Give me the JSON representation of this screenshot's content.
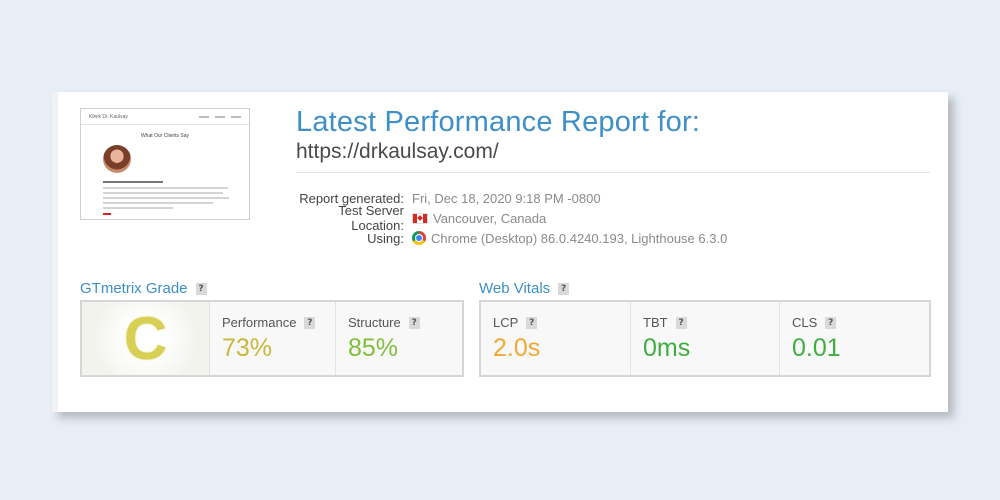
{
  "report": {
    "title": "Latest Performance Report for:",
    "url": "https://drkaulsay.com/",
    "meta": [
      {
        "label": "Report generated:",
        "value": "Fri, Dec 18, 2020 9:18 PM -0800",
        "icon": ""
      },
      {
        "label": "Test Server Location:",
        "value": "Vancouver, Canada",
        "icon": "canada-flag-icon"
      },
      {
        "label": "Using:",
        "value": "Chrome (Desktop) 86.0.4240.193, Lighthouse 6.3.0",
        "icon": "chrome-icon"
      }
    ]
  },
  "thumbnail": {
    "brand": "Klinik Dr. Kaulsay",
    "heading": "What Our Clients Say"
  },
  "gtmetrix": {
    "label": "GTmetrix Grade",
    "help": "?",
    "grade": "C",
    "grade_color": "#d8cf55",
    "performance": {
      "label": "Performance",
      "value": "73%",
      "color": "#c9b73a"
    },
    "structure": {
      "label": "Structure",
      "value": "85%",
      "color": "#7fbf3a"
    }
  },
  "web_vitals": {
    "label": "Web Vitals",
    "help": "?",
    "lcp": {
      "label": "LCP",
      "value": "2.0s",
      "color": "#f0a830"
    },
    "tbt": {
      "label": "TBT",
      "value": "0ms",
      "color": "#3fae3f"
    },
    "cls": {
      "label": "CLS",
      "value": "0.01",
      "color": "#3fae3f"
    }
  }
}
